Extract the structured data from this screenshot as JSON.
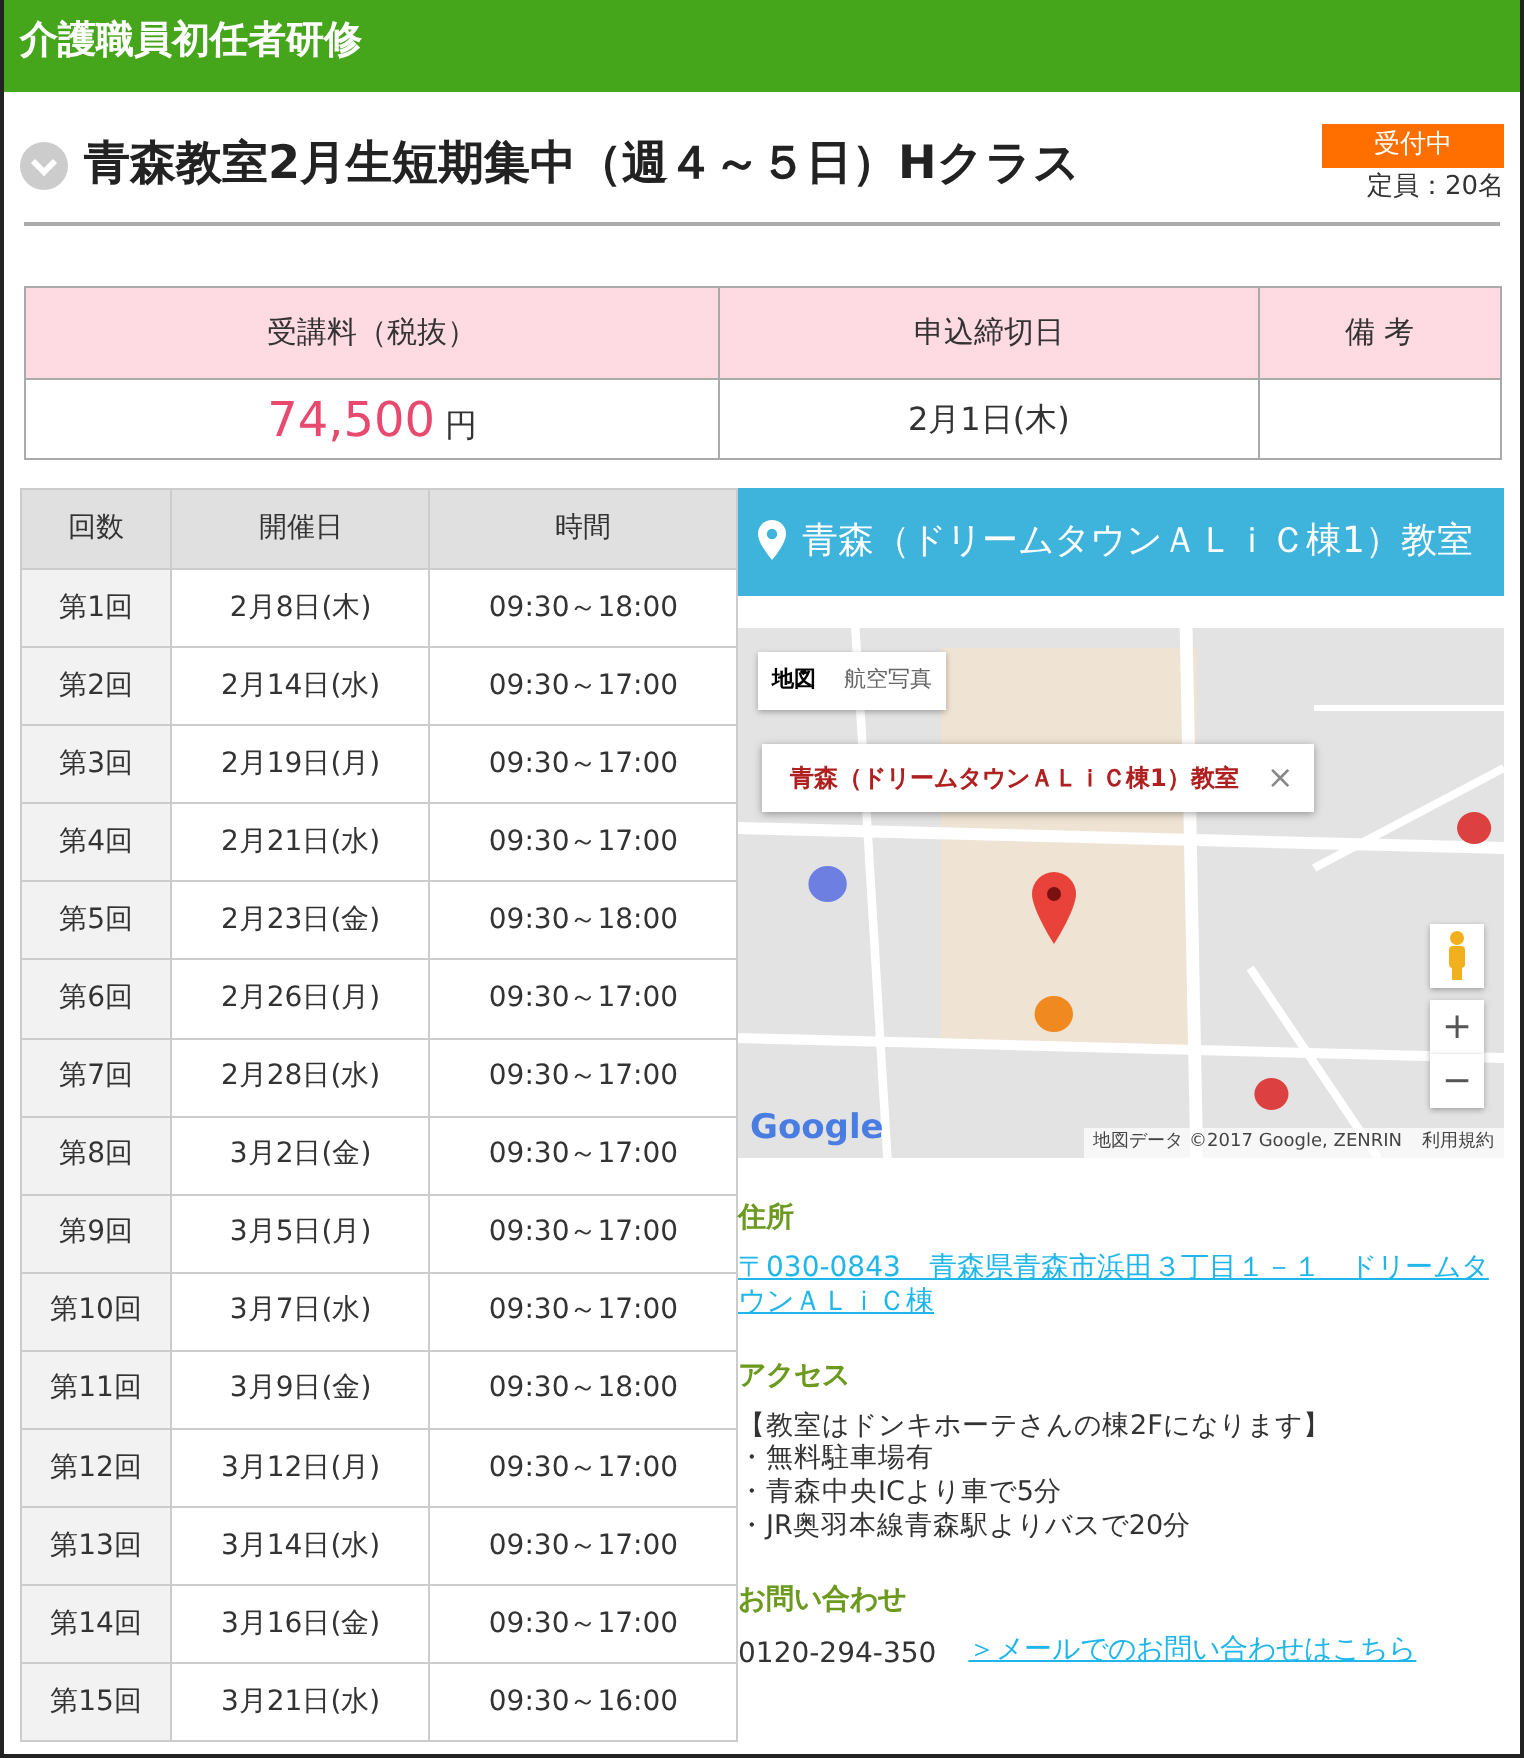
{
  "header": {
    "title": "介護職員初任者研修"
  },
  "course": {
    "title": "青森教室2月生短期集中（週４～５日）Hクラス",
    "status": "受付中",
    "capacity": "定員：20名"
  },
  "fee_table": {
    "columns": [
      "受講料（税抜）",
      "申込締切日",
      "備 考"
    ],
    "price": "74,500",
    "currency": "円",
    "deadline": "2月1日(木)"
  },
  "schedule": {
    "columns": [
      "回数",
      "開催日",
      "時間"
    ],
    "rows": [
      [
        "第1回",
        "2月8日(木)",
        "09:30～18:00"
      ],
      [
        "第2回",
        "2月14日(水)",
        "09:30～17:00"
      ],
      [
        "第3回",
        "2月19日(月)",
        "09:30～17:00"
      ],
      [
        "第4回",
        "2月21日(水)",
        "09:30～17:00"
      ],
      [
        "第5回",
        "2月23日(金)",
        "09:30～18:00"
      ],
      [
        "第6回",
        "2月26日(月)",
        "09:30～17:00"
      ],
      [
        "第7回",
        "2月28日(水)",
        "09:30～17:00"
      ],
      [
        "第8回",
        "3月2日(金)",
        "09:30～17:00"
      ],
      [
        "第9回",
        "3月5日(月)",
        "09:30～17:00"
      ],
      [
        "第10回",
        "3月7日(水)",
        "09:30～17:00"
      ],
      [
        "第11回",
        "3月9日(金)",
        "09:30～18:00"
      ],
      [
        "第12回",
        "3月12日(月)",
        "09:30～17:00"
      ],
      [
        "第13回",
        "3月14日(水)",
        "09:30～17:00"
      ],
      [
        "第14回",
        "3月16日(金)",
        "09:30～17:00"
      ],
      [
        "第15回",
        "3月21日(水)",
        "09:30～16:00"
      ]
    ]
  },
  "venue": {
    "title": "青森（ドリームタウンＡＬｉＣ棟1）教室",
    "map": {
      "types": [
        {
          "label": "地図",
          "selected": true
        },
        {
          "label": "航空写真",
          "selected": false
        }
      ],
      "info_title": "青森（ドリームタウンＡＬｉＣ棟1）教室",
      "close": "×",
      "zoom_in": "+",
      "zoom_out": "−",
      "logo": "Google",
      "attribution": "地図データ ©2017 Google, ZENRIN",
      "terms": "利用規約"
    },
    "sections": [
      {
        "kind": "link",
        "heading": "住所",
        "lines": [
          "〒030-0843　青森県青森市浜田３丁目１－１　ドリームタウンＡＬｉＣ棟"
        ]
      },
      {
        "kind": "text",
        "heading": "アクセス",
        "lines": [
          "【教室はドンキホーテさんの棟2Fになります】",
          "・無料駐車場有",
          "・青森中央ICより車で5分",
          "・JR奥羽本線青森駅よりバスで20分"
        ]
      },
      {
        "kind": "contact",
        "heading": "お問い合わせ",
        "phone": "0120-294-350",
        "link": "＞メールでのお問い合わせはこちら"
      }
    ]
  }
}
